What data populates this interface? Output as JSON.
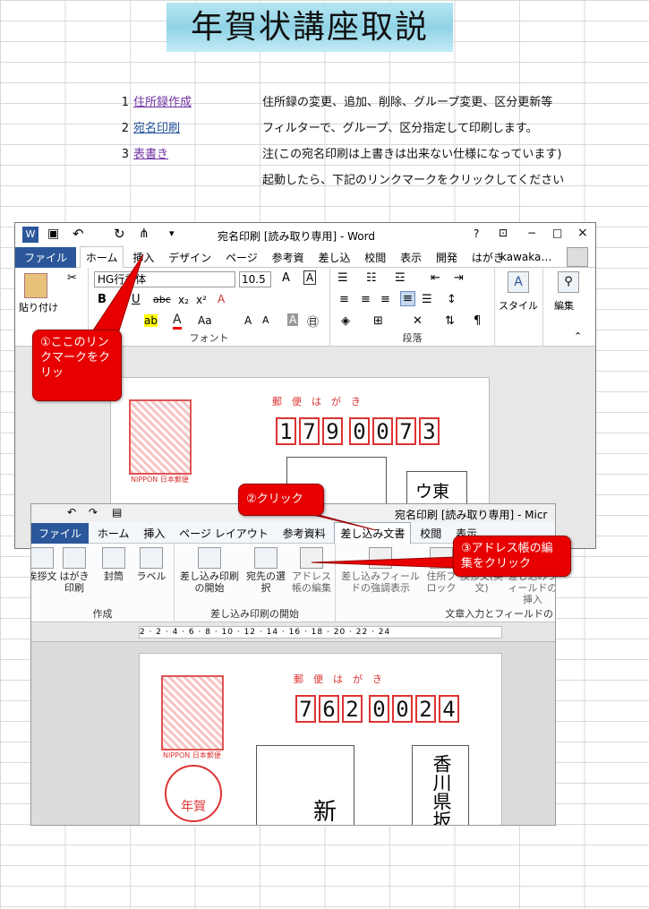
{
  "title": "年賀状講座取説",
  "rows": [
    {
      "num": "1",
      "link": "住所録作成",
      "desc": "住所録の変更、追加、削除、グループ変更、区分更新等"
    },
    {
      "num": "2",
      "link": "宛名印刷",
      "desc": "フィルターで、グループ、区分指定して印刷します。"
    },
    {
      "num": "3",
      "link": "表書き",
      "desc": "注(この宛名印刷は上書きは出来ない仕様になっています)"
    }
  ],
  "note": "起動したら、下記のリンクマークをクリックしてください",
  "colors": {
    "link1": "#7030a0",
    "link2": "#1f4e9a",
    "link3": "#7030a0",
    "callout": "#e80000",
    "ribbon_file": "#2b579a",
    "zip_border": "#dd3333"
  },
  "shotA": {
    "window_title": "宛名印刷 [読み取り専用] - Word",
    "help": "?",
    "win_controls": [
      "−",
      "□",
      "×"
    ],
    "tabs": [
      "ファイル",
      "ホーム",
      "挿入",
      "デザイン",
      "ページ",
      "参考資",
      "差し込",
      "校閲",
      "表示",
      "開発",
      "はがき"
    ],
    "user": "kawaka…",
    "font_name": "HG行書体",
    "font_size": "10.5",
    "paste": "貼り付け",
    "group_font": "フォント",
    "group_para": "段落",
    "style": "スタイル",
    "edit": "編集",
    "postcard_label": "郵便はがき",
    "zip": [
      "1",
      "7",
      "9",
      "0",
      "0",
      "7",
      "3"
    ],
    "addr_partial": "ウ東",
    "brand": "NIPPON 日本郵便"
  },
  "shotB": {
    "window_title": "宛名印刷 [読み取り専用] - Micr",
    "tabs": [
      "ファイル",
      "ホーム",
      "挿入",
      "ページ レイアウト",
      "参考資料",
      "差し込み文書",
      "校閲",
      "表示"
    ],
    "b1": "挨拶文",
    "b2": "はがき印刷",
    "b3": "封筒",
    "b4": "ラベル",
    "b5": "差し込み印刷の開始",
    "b6": "宛先の選択",
    "b7": "アドレス帳の編集",
    "b8": "差し込みフィールドの強調表示",
    "b9": "住所ブロック",
    "b10": "挨拶文(英文)",
    "b11": "差し込みフィールドの挿入",
    "grp1": "作成",
    "grp2": "差し込み印刷の開始",
    "grp3": "文章入力とフィールドの",
    "ruler": "2 · 2 · 4 · 6 · 8 · 10 · 12 · 14 · 16 · 18 · 20 · 22 · 24",
    "postcard_label": "郵便はがき",
    "zip": [
      "7",
      "6",
      "2",
      "0",
      "0",
      "2",
      "4"
    ],
    "addressee": "新",
    "addr_vertical": "香川県坂",
    "stamp_text": "年賀",
    "brand": "NIPPON 日本郵便"
  },
  "callouts": {
    "c1": "①ここのリンクマークをクリッ",
    "c2": "②クリック",
    "c3": "③アドレス帳の編集をクリック"
  }
}
